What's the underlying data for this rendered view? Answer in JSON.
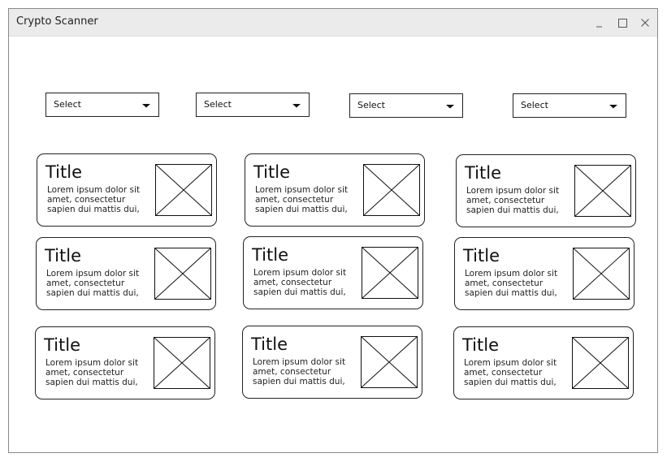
{
  "window": {
    "title": "Crypto Scanner"
  },
  "filters": [
    {
      "selected": "Select"
    },
    {
      "selected": "Select"
    },
    {
      "selected": "Select"
    },
    {
      "selected": "Select"
    }
  ],
  "cards": [
    {
      "title": "Title",
      "body": "Lorem ipsum dolor sit amet, consectetur sapien dui mattis dui,"
    },
    {
      "title": "Title",
      "body": "Lorem ipsum dolor sit amet, consectetur sapien dui mattis dui,"
    },
    {
      "title": "Title",
      "body": "Lorem ipsum dolor sit amet, consectetur sapien dui mattis dui,"
    },
    {
      "title": "Title",
      "body": "Lorem ipsum dolor sit amet, consectetur sapien dui mattis dui,"
    },
    {
      "title": "Title",
      "body": "Lorem ipsum dolor sit amet, consectetur sapien dui mattis dui,"
    },
    {
      "title": "Title",
      "body": "Lorem ipsum dolor sit amet, consectetur sapien dui mattis dui,"
    },
    {
      "title": "Title",
      "body": "Lorem ipsum dolor sit amet, consectetur sapien dui mattis dui,"
    },
    {
      "title": "Title",
      "body": "Lorem ipsum dolor sit amet, consectetur sapien dui mattis dui,"
    },
    {
      "title": "Title",
      "body": "Lorem ipsum dolor sit amet, consectetur sapien dui mattis dui,"
    }
  ],
  "icons": {
    "minimize": "minimize-icon",
    "maximize": "maximize-icon",
    "close": "close-icon",
    "dropdown": "chevron-down-icon",
    "image_placeholder": "image-placeholder-icon"
  }
}
